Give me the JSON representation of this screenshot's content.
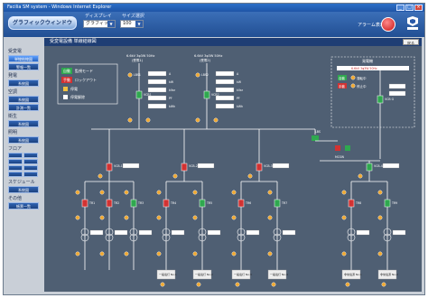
{
  "window": {
    "title": "Facilia SM system - Windows Internet Explorer"
  },
  "toolbar": {
    "app_button": "グラフィックウィンドウ",
    "display_label": "ディスプレイ",
    "display_value": "グラフィック",
    "size_label": "サイズ選択",
    "size_value": "100",
    "alarm_label": "アラーム表示"
  },
  "screen": {
    "title": "受変電設備 単線結線図",
    "close_label": "戻る"
  },
  "sidebar": {
    "groups": [
      {
        "label": "受変電",
        "buttons": [
          "単線結線図",
          "警報一覧"
        ]
      },
      {
        "label": "発電",
        "buttons": [
          "系統図"
        ]
      },
      {
        "label": "空調",
        "buttons": [
          "系統図",
          "計測一覧"
        ]
      },
      {
        "label": "衛生",
        "buttons": [
          "系統図"
        ]
      },
      {
        "label": "照明",
        "buttons": [
          "系統図"
        ]
      },
      {
        "label": "フロア",
        "grid": 8
      },
      {
        "label": "スケジュール",
        "buttons": [
          "系統図"
        ]
      },
      {
        "label": "その他",
        "buttons": [
          "帳票一覧"
        ]
      }
    ]
  },
  "legend": {
    "auto_label": "自動",
    "auto_desc": "監視モード",
    "manual_label": "手動",
    "manual_desc": "ロックアウト",
    "on_label": "停電",
    "off_label": "停電解除"
  },
  "diagram": {
    "incoming": [
      {
        "voltage": "6.6kV 3φ3W 50Hz",
        "name": "(受電1)",
        "lbs": "LBS1",
        "vcb": "VCB1",
        "readings": [
          "A",
          "kW",
          "kVar",
          "PF",
          "kWh"
        ]
      },
      {
        "voltage": "6.6kV 3φ3W 50Hz",
        "name": "(受電2)",
        "lbs": "LBS2",
        "vcb": "VCB2",
        "readings": [
          "A",
          "kW",
          "kVar",
          "PF",
          "kWh"
        ]
      }
    ],
    "generator": {
      "title": "発電機",
      "rating": "6.6kV 3φ3W 50Hz",
      "auto": "自動",
      "manual": "手動",
      "states": [
        "運転中",
        "停止中"
      ],
      "vcb": "VCB G"
    },
    "tie_label": "LBS",
    "mc_label": "MCSW",
    "feeders": [
      {
        "vcb": "VCB-1",
        "transformers": [
          "TR1",
          "TR2",
          "TR3"
        ],
        "loads": []
      },
      {
        "vcb": "VCB-2",
        "transformers": [
          "TR4",
          "TR5"
        ],
        "loads": [
          "一般電灯 No.1",
          "一般電灯 No.2"
        ]
      },
      {
        "vcb": "VCB-3",
        "transformers": [
          "TR6",
          "TR7"
        ],
        "loads": [
          "一般電灯 No.3",
          "一般電灯 No.4"
        ]
      },
      {
        "vcb": "VCB-4",
        "transformers": [
          "TR8",
          "TR9"
        ],
        "loads": [
          "非常電源 No.1",
          "非常電源 No.2"
        ]
      }
    ]
  },
  "colors": {
    "panel": "#4f5f73",
    "line": "#ffffff",
    "closed": "#2fa84f",
    "open": "#d23232",
    "meter": "#f0a830"
  }
}
